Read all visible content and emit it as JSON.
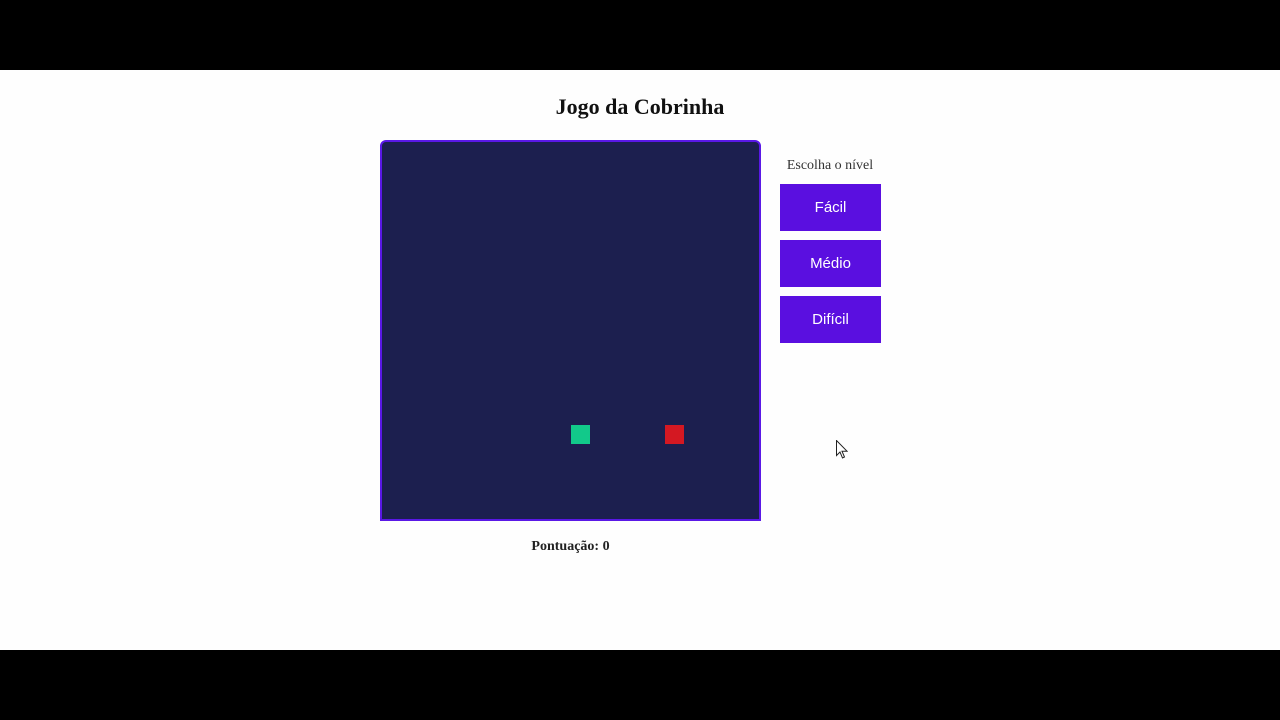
{
  "page": {
    "title": "Jogo da Cobrinha"
  },
  "score": {
    "label": "Pontuação: 0",
    "value": 0
  },
  "level_panel": {
    "label": "Escolha o nível",
    "buttons": [
      {
        "label": "Fácil"
      },
      {
        "label": "Médio"
      },
      {
        "label": "Difícil"
      }
    ]
  },
  "game": {
    "grid_cells": 20,
    "snake": [
      {
        "col": 10,
        "row": 15
      }
    ],
    "food": {
      "col": 15,
      "row": 15
    }
  },
  "colors": {
    "board": "#1c1f4f",
    "border": "#5a18e6",
    "button": "#5a0fe0",
    "snake": "#12c98a",
    "food": "#d41822"
  },
  "icons": {
    "cursor": "mouse-pointer-icon"
  }
}
